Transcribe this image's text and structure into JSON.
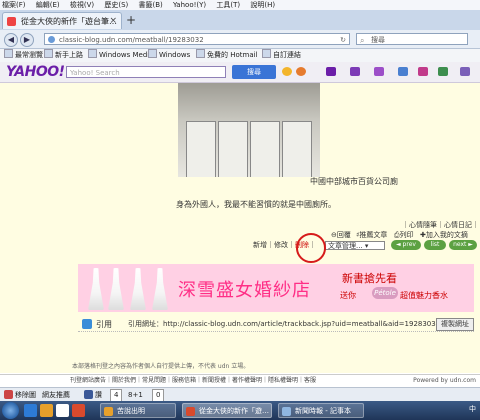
{
  "menu": [
    "檔案(F)",
    "編輯(E)",
    "檢視(V)",
    "歷史(S)",
    "書籤(B)",
    "Yahoo!(Y)",
    "工具(T)",
    "說明(H)"
  ],
  "tabs": [
    {
      "label": "從金大俠的新作「遊台筆…"
    }
  ],
  "nav": {
    "url": "classic-blog.udn.com/meatball/19283032",
    "search_placeholder": "搜尋"
  },
  "bookmarks": [
    "最常瀏覽",
    "新手上路",
    "Windows Media",
    "Windows",
    "免費的 Hotmail",
    "自訂連結"
  ],
  "yahoo": {
    "logo": "YAHOO!",
    "search_placeholder": "Yahoo! Search",
    "search_button": "搜尋"
  },
  "post": {
    "caption1": "中國中部城市百貨公司廁",
    "caption2": "身為外國人，我最不能習慣的就是中國廁所。",
    "top_links": "｜心情隨筆｜心情日記｜",
    "actions": [
      "回覆",
      "推薦文章",
      "列印",
      "加入我的文摘"
    ],
    "tools": [
      "新增",
      "修改",
      "刪除"
    ],
    "category_select": "文章管理...",
    "nav_buttons": [
      "◄ prev",
      "list",
      "next ►"
    ]
  },
  "banner": {
    "title": "深雪盛女婚紗店",
    "new_book": "新書搶先看",
    "gift": "送你",
    "brand": "Pétole",
    "gift_tail": "超值魅力香水"
  },
  "trackback": {
    "label": "引用",
    "url": "引用網址：http://classic-blog.udn.com/article/trackback.jsp?uid=meatball&aid=19283032",
    "copy_button": "複製網址"
  },
  "notice": "本部落格刊登之內容為作者個人自行提供上傳，不代表 udn 立場。",
  "footer": {
    "links": "刊登網站廣告｜關於我們｜常見問題｜服務信箱｜新聞授權｜著作權聲明｜隱私權聲明｜客服",
    "powered": "Powered by udn.com"
  },
  "status": {
    "item1": "移除圖",
    "item2": "網友推薦",
    "like": "讚",
    "like_count": "4",
    "gplus": "8+1",
    "gplus_count": "0"
  },
  "taskbar": {
    "tasks": [
      "苦說出明",
      "從金大俠的新作「遊…",
      "新聞時報 - 記事本"
    ],
    "tray": "中"
  },
  "colors": {
    "page_bg": "#fffde2",
    "yahoo_purple": "#6b1ea8",
    "banner_pink": "#ff2f86",
    "circle_red": "#d61b1b"
  }
}
